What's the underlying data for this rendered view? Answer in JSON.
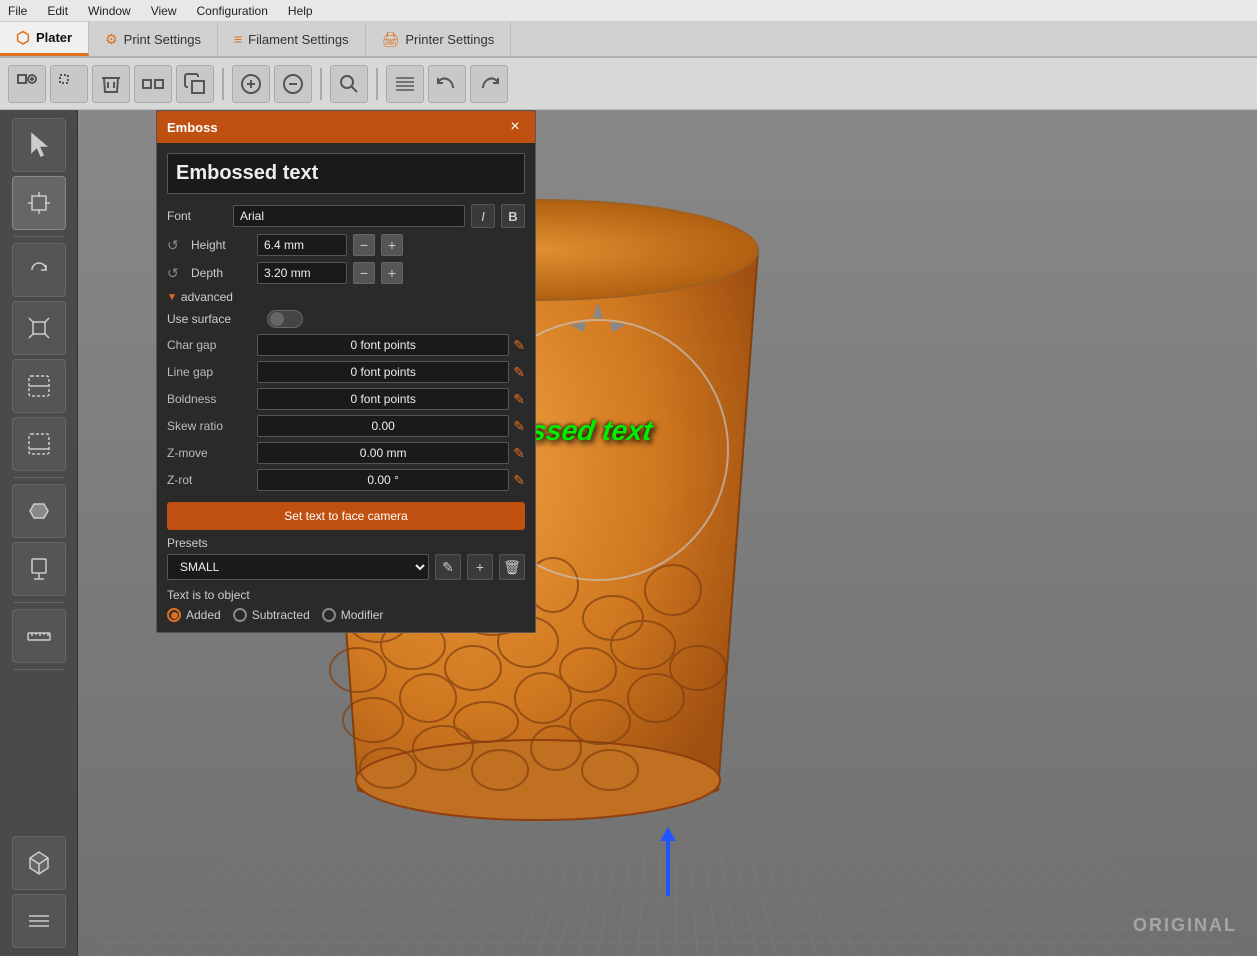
{
  "menubar": {
    "items": [
      "File",
      "Edit",
      "Window",
      "View",
      "Configuration",
      "Help"
    ]
  },
  "tabs": [
    {
      "label": "Plater",
      "active": true
    },
    {
      "label": "Print Settings",
      "active": false
    },
    {
      "label": "Filament Settings",
      "active": false
    },
    {
      "label": "Printer Settings",
      "active": false
    }
  ],
  "emboss_panel": {
    "title": "Emboss",
    "close_btn": "×",
    "embossed_text": "Embossed text",
    "font_label": "Font",
    "font_value": "Arial",
    "height_label": "Height",
    "height_value": "6.4 mm",
    "depth_label": "Depth",
    "depth_value": "3.20 mm",
    "advanced_label": "advanced",
    "use_surface_label": "Use surface",
    "char_gap_label": "Char gap",
    "char_gap_value": "0 font points",
    "line_gap_label": "Line gap",
    "line_gap_value": "0 font points",
    "boldness_label": "Boldness",
    "boldness_value": "0 font points",
    "skew_ratio_label": "Skew ratio",
    "skew_ratio_value": "0.00",
    "z_move_label": "Z-move",
    "z_move_value": "0.00 mm",
    "z_rot_label": "Z-rot",
    "z_rot_value": "0.00 °",
    "face_camera_btn": "Set text to face camera",
    "presets_label": "Presets",
    "preset_value": "SMALL",
    "text_is_to_object_label": "Text is to object",
    "radio_added": "Added",
    "radio_subtracted": "Subtracted",
    "radio_modifier": "Modifier"
  },
  "viewport": {
    "cup_text": "Embossed text",
    "original_label": "ORIGINAL"
  }
}
